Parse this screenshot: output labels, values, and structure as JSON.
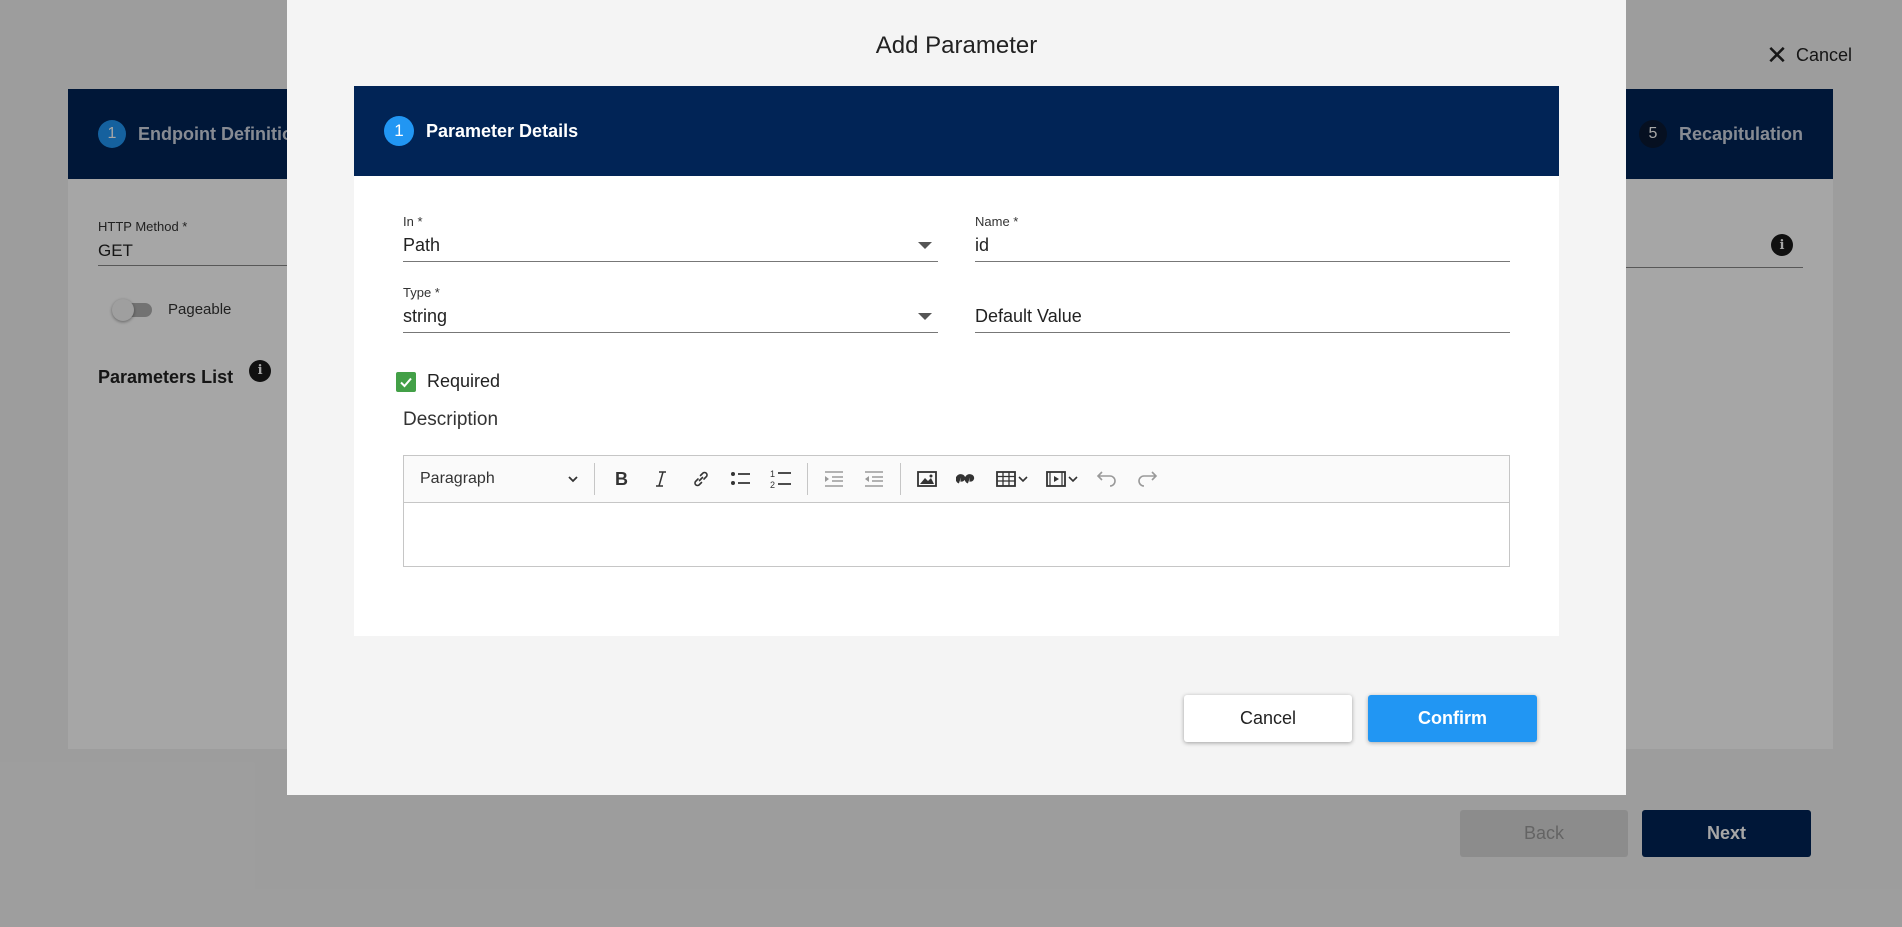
{
  "background": {
    "cancel_label": "Cancel",
    "stepper": {
      "first_step": {
        "number": "1",
        "label": "Endpoint Definition"
      },
      "last_step": {
        "number": "5",
        "label": "Recapitulation"
      }
    },
    "http_method": {
      "label": "HTTP Method *",
      "value": "GET"
    },
    "pageable_label": "Pageable",
    "parameters_list_label": "Parameters List",
    "back_label": "Back",
    "next_label": "Next"
  },
  "modal": {
    "title": "Add Parameter",
    "step": {
      "number": "1",
      "label": "Parameter Details"
    },
    "fields": {
      "in": {
        "label": "In *",
        "value": "Path"
      },
      "name": {
        "label": "Name *",
        "value": "id"
      },
      "type": {
        "label": "Type *",
        "value": "string"
      },
      "default_value": {
        "placeholder": "Default Value"
      }
    },
    "required": {
      "label": "Required",
      "checked": true
    },
    "description_label": "Description",
    "editor": {
      "format_select": "Paragraph",
      "toolbar_icons": [
        "bold-icon",
        "italic-icon",
        "link-icon",
        "bulleted-list-icon",
        "numbered-list-icon",
        "outdent-icon",
        "indent-icon",
        "image-icon",
        "block-quote-icon",
        "table-icon",
        "media-icon",
        "undo-icon",
        "redo-icon"
      ]
    },
    "cancel_label": "Cancel",
    "confirm_label": "Confirm"
  },
  "colors": {
    "header_navy": "#012456",
    "accent_blue": "#2196f3",
    "checkbox_green": "#43a047"
  }
}
